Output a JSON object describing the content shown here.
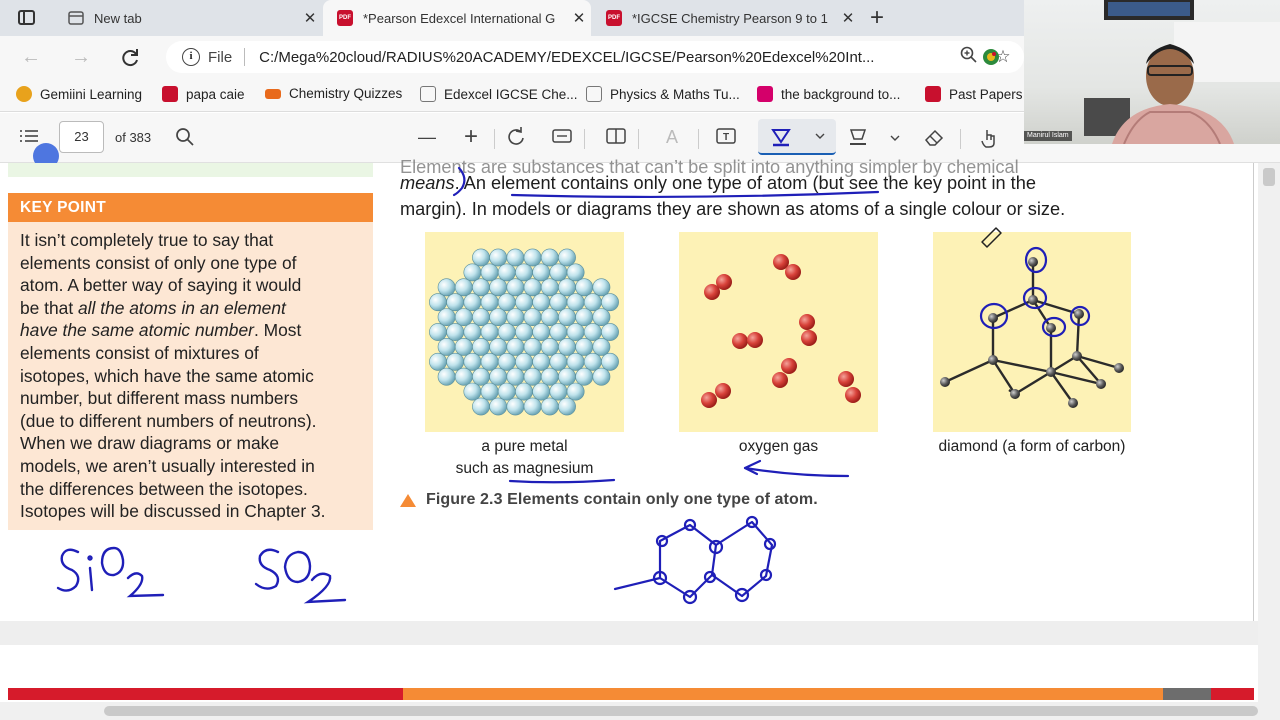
{
  "tabs": [
    {
      "title": "New tab",
      "active": false
    },
    {
      "title": "*Pearson Edexcel International G",
      "active": true
    },
    {
      "title": "*IGCSE Chemistry Pearson 9 to 1",
      "active": false
    }
  ],
  "address": {
    "file_label": "File",
    "url": "C:/Mega%20cloud/RADIUS%20ACADEMY/EDEXCEL/IGCSE/Pearson%20Edexcel%20Int..."
  },
  "bookmarks": [
    {
      "label": "Gemiini Learning",
      "color": "#e8a21c"
    },
    {
      "label": "papa caie",
      "color": "#c8102e"
    },
    {
      "label": "Chemistry Quizzes",
      "color": "#e86a1c"
    },
    {
      "label": "Edexcel IGCSE Che...",
      "color": "#888888"
    },
    {
      "label": "Physics & Maths Tu...",
      "color": "#888888"
    },
    {
      "label": "the background to...",
      "color": "#d4006a"
    },
    {
      "label": "Past Papers",
      "color": "#c8102e"
    }
  ],
  "pdf_toolbar": {
    "page": "23",
    "of_pages": "of 383"
  },
  "key_point": {
    "heading": "KEY POINT",
    "lines": [
      "It isn’t completely true to say that",
      "elements consist of only one type of",
      "atom. A better way of saying it would",
      "be that ",
      "all the atoms in an element",
      "have the same atomic number",
      ". Most",
      "elements consist of mixtures of",
      "isotopes, which have the same atomic",
      "number, but different mass numbers",
      "(due to different numbers of neutrons).",
      "When we draw diagrams or make",
      "models, we aren’t usually interested in",
      "the differences between the isotopes.",
      "Isotopes will be discussed in Chapter 3."
    ]
  },
  "main_text": {
    "clipped_line": "Elements are substances that can’t be split into anything simpler by chemical",
    "line1_italic": "means",
    "line1_rest": ". An element contains only one type of atom (but see the key point in the",
    "line2": "margin). In models or diagrams they are shown as atoms of a single colour or size."
  },
  "figure": {
    "captions": [
      "a pure metal",
      "such as magnesium",
      "oxygen gas",
      "diamond (a form of carbon)"
    ],
    "figure_caption": "Figure 2.3 Elements contain only one type of atom."
  },
  "handwriting": {
    "formula1": "SiO2",
    "formula2": "SO2"
  },
  "webcam": {
    "name": "Manirul Islam"
  },
  "colors": {
    "ink": "#1f1fb8",
    "key_point_orange": "#f58b35",
    "key_point_bg": "#fde7d4",
    "figure_panel": "#fdf2b6"
  }
}
